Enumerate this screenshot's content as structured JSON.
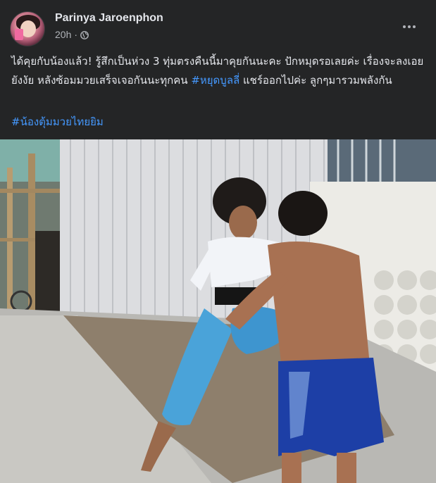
{
  "post": {
    "author": "Parinya Jaroenphon",
    "time": "20h",
    "privacy_icon": "globe-icon",
    "more_icon": "more-options-icon",
    "text_part1": "ได้คุยกับน้องแล้ว! รู้สึกเป็นห่วง 3 ทุ่มตรงคืนนี้มาคุยกันนะคะ ปักหมุดรอเลยค่ะ เรื่องจะลงเอยยังงัย หลังซ้อมมวยเสร็จเจอกันนะทุกคน ",
    "hashtag1": "#หยุดบูลลี่",
    "text_part2": " แชร์ออกไปค่ะ ลูกๆมารวมพลังกัน",
    "hashtag2": "#น้องตุ้มมวยไทยยิม"
  }
}
